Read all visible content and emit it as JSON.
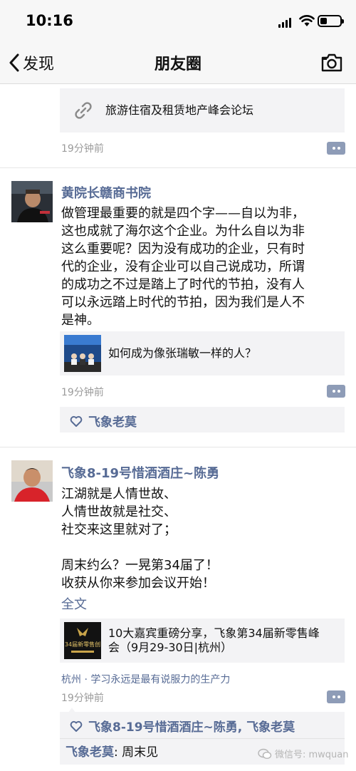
{
  "status": {
    "time": "10:16"
  },
  "nav": {
    "back_label": "发现",
    "title": "朋友圈",
    "camera_icon": "camera-icon"
  },
  "post0": {
    "link_title": "旅游住宿及租赁地产峰会论坛",
    "time": "19分钟前"
  },
  "post1": {
    "name": "黄院长赣商书院",
    "text": "做管理最重要的就是四个字——自以为非，\n这也成就了海尔这个企业。为什么自以为非\n这么重要呢？因为没有成功的企业，只有时\n代的企业，没有企业可以自己说成功，所谓\n的成功之不过是踏上了时代的节拍，没有人\n可以永远踏上时代的节拍，因为我们是人不\n是神。",
    "link_title": "如何成为像张瑞敏一样的人？",
    "time": "19分钟前",
    "likes": "飞象老莫"
  },
  "post2": {
    "name": "飞象8-19号惜酒酒庄~陈勇",
    "text": "江湖就是人情世故、\n人情世故就是社交、\n社交来这里就对了；\n\n周末约么？一晃第34届了！\n收获从你来参加会议开始！",
    "full_text_label": "全文",
    "link_title_line1": "10大嘉宾重磅分享，飞象第34届新零售峰",
    "link_title_line2": "会（9月29-30日|杭州）",
    "link_thumb_text": "34届新零售创",
    "location": "杭州 · 学习永远是最有说服力的生产力",
    "time": "19分钟前",
    "likes": "飞象8-19号惜酒酒庄~陈勇, 飞象老莫",
    "comment_author": "飞象老莫",
    "comment_text": ": 周末见"
  },
  "watermark": {
    "text": "微信号: mwquan"
  },
  "colors": {
    "link_blue": "#576b95",
    "bg_gray": "#f3f3f5",
    "time_gray": "#9b9b9b"
  }
}
